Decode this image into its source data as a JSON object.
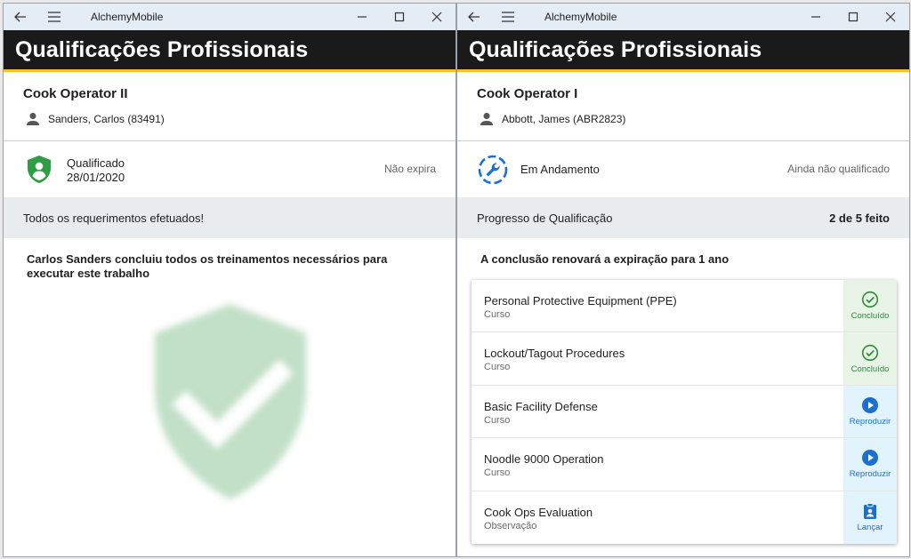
{
  "left": {
    "app_title": "AlchemyMobile",
    "header_title": "Qualificações Profissionais",
    "job_title": "Cook Operator II",
    "user": "Sanders, Carlos (83491)",
    "status_label": "Qualificado",
    "status_date": "28/01/2020",
    "status_right": "Não expira",
    "band_text": "Todos os requerimentos efetuados!",
    "message": "Carlos Sanders concluiu todos os treinamentos necessários para executar este trabalho",
    "colors": {
      "shield": "#2e9e44",
      "accent": "#f5c31c"
    }
  },
  "right": {
    "app_title": "AlchemyMobile",
    "header_title": "Qualificações Profissionais",
    "job_title": "Cook Operator I",
    "user": "Abbott, James (ABR2823)",
    "status_label": "Em Andamento",
    "status_right": "Ainda não qualificado",
    "band_text": "Progresso de Qualificação",
    "band_count": "2 de 5 feito",
    "message": "A conclusão renovará a expiração para 1 ano",
    "items": [
      {
        "title": "Personal Protective Equipment (PPE)",
        "type": "Curso",
        "action": "Concluído",
        "icon": "check-circle-icon"
      },
      {
        "title": "Lockout/Tagout Procedures",
        "type": "Curso",
        "action": "Concluído",
        "icon": "check-circle-icon"
      },
      {
        "title": "Basic Facility Defense",
        "type": "Curso",
        "action": "Reproduzir",
        "icon": "play-circle-icon"
      },
      {
        "title": "Noodle 9000 Operation",
        "type": "Curso",
        "action": "Reproduzir",
        "icon": "play-circle-icon"
      },
      {
        "title": "Cook Ops Evaluation",
        "type": "Observação",
        "action": "Lançar",
        "icon": "clipboard-user-icon"
      }
    ],
    "colors": {
      "done": "#2e8b3a",
      "play": "#1b6fd0"
    }
  }
}
